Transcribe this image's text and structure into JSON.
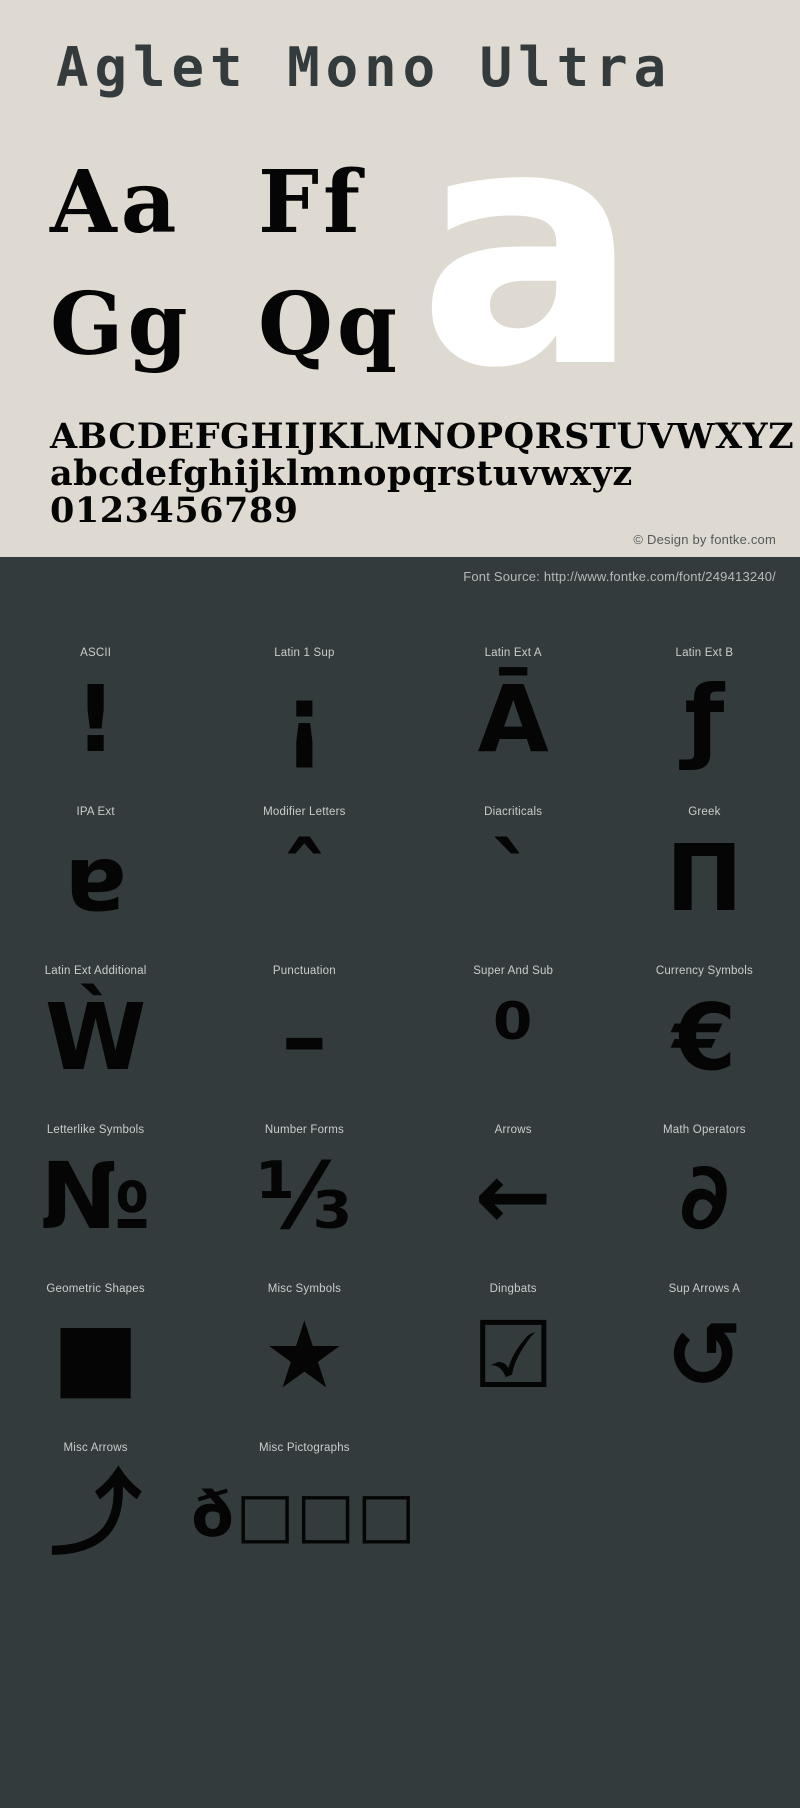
{
  "colors": {
    "light_bg": "#dedad1",
    "dark_bg": "#333b3d",
    "glyph_black": "#050505",
    "hero_white": "#ffffff",
    "label_grey": "#c9cdcb",
    "copyright_grey": "#55595a"
  },
  "specimen": {
    "title": "Aglet Mono Ultra",
    "pairs": [
      {
        "text": "Aa"
      },
      {
        "text": "Ff"
      },
      {
        "text": "Gg"
      },
      {
        "text": "Qq"
      }
    ],
    "hero_glyph": "a",
    "alphabet": [
      "ABCDEFGHIJKLMNOPQRSTUVWXYZ",
      "abcdefghijklmnopqrstuvwxyz",
      "0123456789"
    ],
    "copyright": "© Design by fontke.com"
  },
  "source_bar": {
    "text": "Font Source: http://www.fontke.com/font/249413240/"
  },
  "ranges": [
    {
      "label": "ASCII",
      "glyph": "!"
    },
    {
      "label": "Latin 1 Sup",
      "glyph": "¡"
    },
    {
      "label": "Latin Ext A",
      "glyph": "Ā"
    },
    {
      "label": "Latin Ext B",
      "glyph": "ƒ"
    },
    {
      "label": "IPA Ext",
      "glyph": "ɐ"
    },
    {
      "label": "Modifier Letters",
      "glyph": "ˆ"
    },
    {
      "label": "Diacriticals",
      "glyph": "ˋ"
    },
    {
      "label": "Greek",
      "glyph": "Π"
    },
    {
      "label": "Latin Ext Additional",
      "glyph": "Ẁ"
    },
    {
      "label": "Punctuation",
      "glyph": "–"
    },
    {
      "label": "Super And Sub",
      "glyph": "⁰"
    },
    {
      "label": "Currency Symbols",
      "glyph": "€"
    },
    {
      "label": "Letterlike Symbols",
      "glyph": "№"
    },
    {
      "label": "Number Forms",
      "glyph": "⅓"
    },
    {
      "label": "Arrows",
      "glyph": "←"
    },
    {
      "label": "Math Operators",
      "glyph": "∂"
    },
    {
      "label": "Geometric Shapes",
      "glyph": "■"
    },
    {
      "label": "Misc Symbols",
      "glyph": "★"
    },
    {
      "label": "Dingbats",
      "glyph": "☑"
    },
    {
      "label": "Sup Arrows A",
      "glyph": "↺"
    },
    {
      "label": "Misc Arrows",
      "glyph": "⤴"
    },
    {
      "label": "Misc Pictographs",
      "glyph": "ð□□□"
    }
  ]
}
